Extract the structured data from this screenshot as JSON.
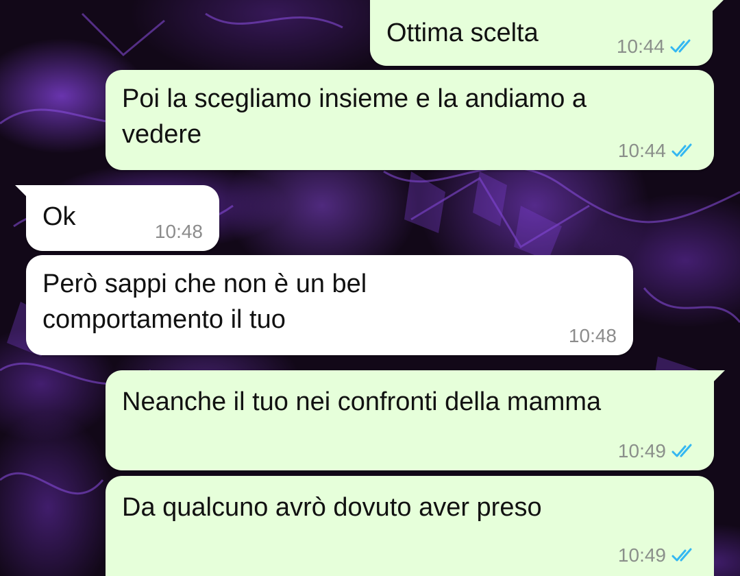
{
  "messages": [
    {
      "direction": "outgoing",
      "text": "Ottima scelta",
      "time": "10:44",
      "status": "read"
    },
    {
      "direction": "outgoing",
      "text": "Poi la scegliamo insieme e la andiamo a\nvedere",
      "time": "10:44",
      "status": "read"
    },
    {
      "direction": "incoming",
      "text": "Ok",
      "time": "10:48"
    },
    {
      "direction": "incoming",
      "text": "Però sappi che non è un bel\ncomportamento il tuo",
      "time": "10:48"
    },
    {
      "direction": "outgoing",
      "text": "Neanche il tuo nei confronti della mamma",
      "time": "10:49",
      "status": "read"
    },
    {
      "direction": "outgoing",
      "text": "Da qualcuno avrò dovuto aver preso",
      "time": "10:49",
      "status": "read"
    }
  ],
  "colors": {
    "outgoing_bubble": "#e6ffda",
    "incoming_bubble": "#ffffff",
    "read_ticks": "#34b7f1",
    "timestamp": "#8a8f8a",
    "wallpaper_accent": "#7a3fd0"
  },
  "icons": {
    "read_status": "double-check-icon"
  }
}
